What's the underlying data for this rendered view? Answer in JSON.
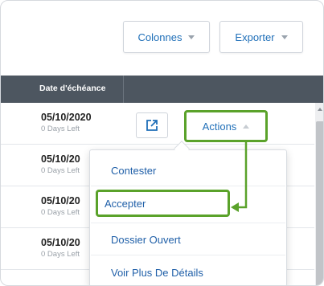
{
  "toolbar": {
    "columns_label": "Colonnes",
    "export_label": "Exporter"
  },
  "table": {
    "header_due_date": "Date d'échéance",
    "rows": [
      {
        "date": "05/10/2020",
        "left": "0 Days Left"
      },
      {
        "date": "05/10/20",
        "left": "0 Days Left"
      },
      {
        "date": "05/10/20",
        "left": "0 Days Left"
      },
      {
        "date": "05/10/20",
        "left": "0 Days Left"
      }
    ]
  },
  "actions": {
    "label": "Actions",
    "menu": [
      "Contester",
      "Accepter",
      "Dossier Ouvert",
      "Voir Plus De Détails"
    ]
  },
  "colors": {
    "accent": "#1f6fb8",
    "highlight": "#5aa22a",
    "header_bg": "#4d5660"
  },
  "icons": {
    "open_external": "open-in-new-icon"
  }
}
